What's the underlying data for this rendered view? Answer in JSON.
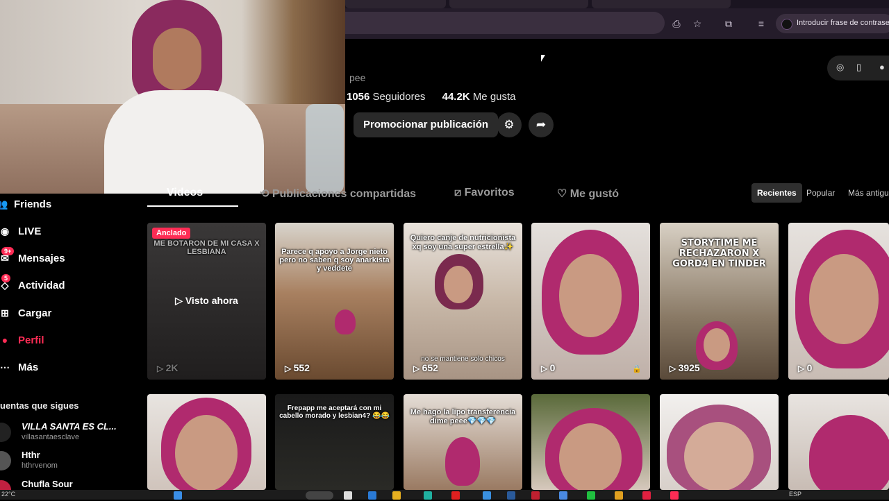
{
  "browser": {
    "profile_text": "Introducir frase de contrase",
    "icons": [
      "install-icon",
      "star-icon",
      "extensions-icon",
      "media-icon"
    ]
  },
  "profile": {
    "username_partial": "pee",
    "followers_count": "1056",
    "followers_label": "Seguidores",
    "likes_count": "44.2K",
    "likes_label": "Me gusta",
    "promote_label": "Promocionar publicación"
  },
  "tabs": {
    "videos": "Videos",
    "shared": "Publicaciones compartidas",
    "favorites": "Favoritos",
    "liked": "Me gustó"
  },
  "sort": {
    "recent": "Recientes",
    "popular": "Popular",
    "oldest": "Más antigu"
  },
  "sidebar": {
    "items": [
      {
        "label": "Friends",
        "icon": "friends-icon"
      },
      {
        "label": "LIVE",
        "icon": "live-icon"
      },
      {
        "label": "Mensajes",
        "icon": "messages-icon",
        "badge": "9+"
      },
      {
        "label": "Actividad",
        "icon": "activity-icon",
        "badge": "5"
      },
      {
        "label": "Cargar",
        "icon": "upload-icon"
      },
      {
        "label": "Perfil",
        "icon": "profile-icon"
      },
      {
        "label": "Más",
        "icon": "more-icon"
      }
    ],
    "following_title": "uentas que sigues",
    "following": [
      {
        "name": "VILLA SANTA ES CL...",
        "handle": "villasantaesclave"
      },
      {
        "name": "Hthr",
        "handle": "hthrvenom"
      },
      {
        "name": "Chufla Sour",
        "handle": ""
      }
    ]
  },
  "videos_row1": [
    {
      "pinned": "Anclado",
      "caption": "ME BOTARON DE MI CASA X LESBIANA",
      "watched": "▷ Visto ahora",
      "views": "2K"
    },
    {
      "caption": "Parece q apoyo a Jorge nieto pero no saben q soy anarkista y veddete",
      "views": "552"
    },
    {
      "caption": "Quiero canje de nutricionista xq soy una super estrella✨",
      "overlay": "no se mantiene solo chicos",
      "views": "652"
    },
    {
      "caption": "",
      "views": "0",
      "locked": true
    },
    {
      "caption": "STORYTIME ME RECHAZARON X GORD4 EN TINDER",
      "views": "3925"
    },
    {
      "caption": "",
      "views": "0"
    }
  ],
  "videos_row2": [
    {
      "caption": ""
    },
    {
      "caption": "Frepapp me aceptará con mi cabello morado y lesbian4? 😂😂"
    },
    {
      "caption": "Me hago la lipo transferencia dime peee💎💎💎"
    },
    {
      "caption": ""
    },
    {
      "caption": ""
    },
    {
      "caption": ""
    }
  ],
  "taskbar": {
    "temperature": "22°C",
    "language": "ESP"
  },
  "colors": {
    "accent": "#fe2c55",
    "background": "#000000"
  }
}
